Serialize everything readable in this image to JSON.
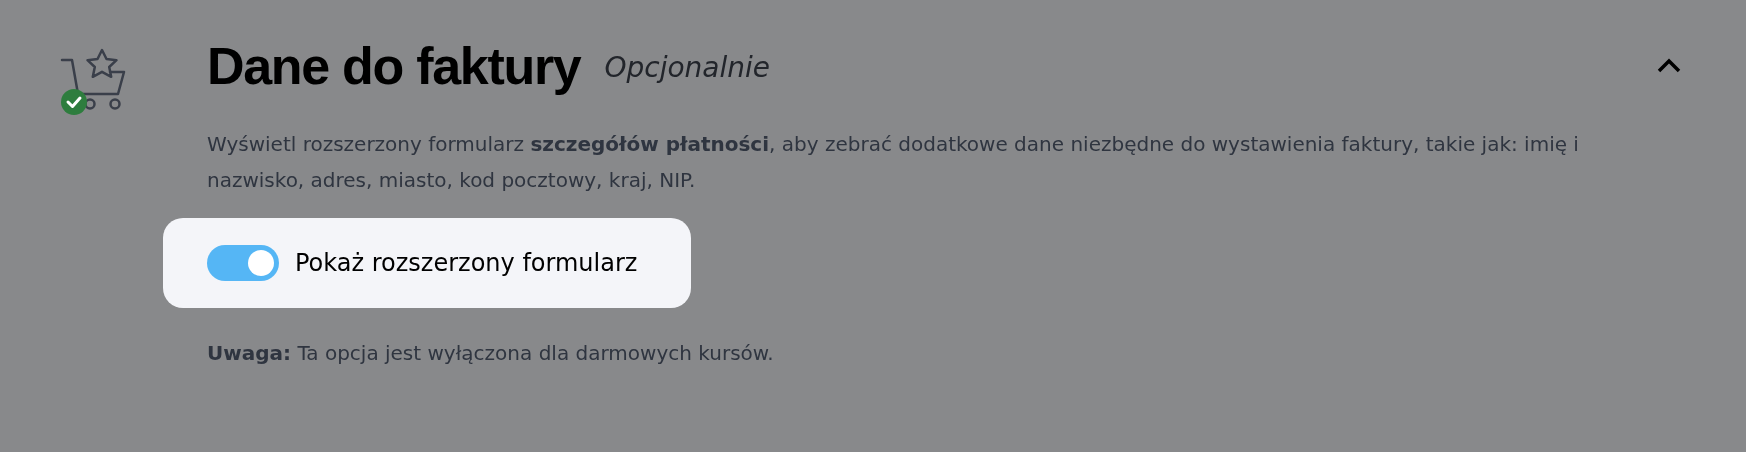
{
  "section": {
    "title": "Dane do faktury",
    "badge": "Opcjonalnie",
    "expanded": true,
    "completed": true
  },
  "description": "Wyświetl rozszerzony formularz **szczegółów płatności**, aby zebrać dodatkowe dane niezbędne do wystawienia faktury, takie jak: imię i nazwisko, adres, miasto, kod pocztowy, kraj, NIP.",
  "toggle": {
    "label": "Pokaż rozszerzony formularz",
    "on": true
  },
  "note": "**Uwaga:** Ta opcja jest wyłączona dla darmowych kursów."
}
